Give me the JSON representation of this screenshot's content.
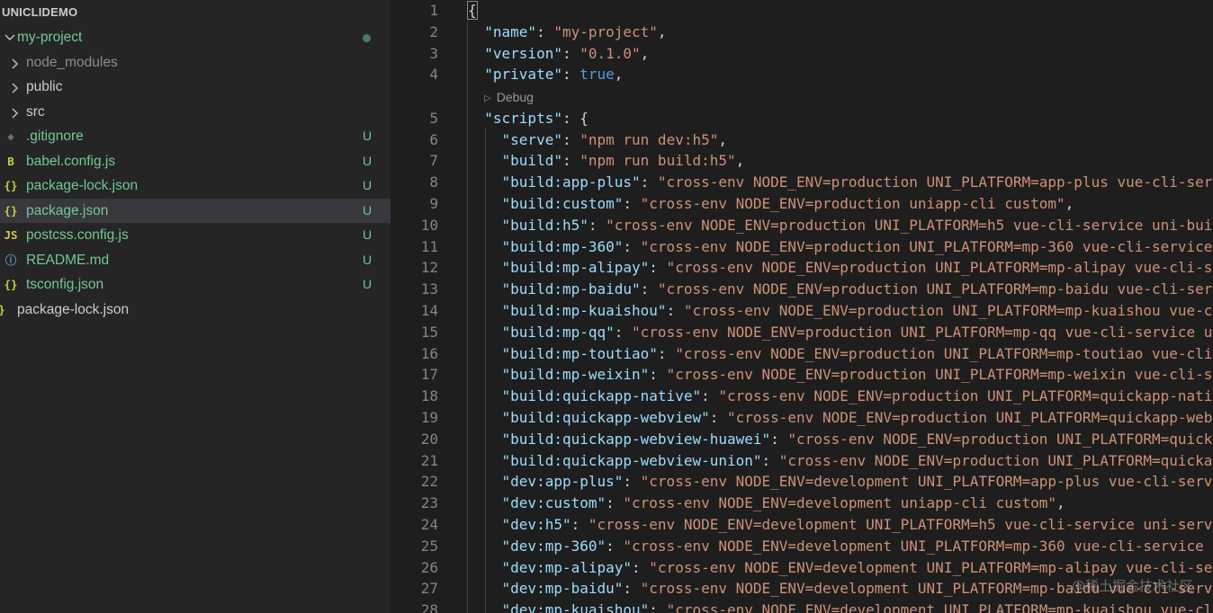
{
  "explorer": {
    "section_title": "UNICLIDEMO",
    "root": {
      "label": "my-project",
      "color": "#73c991"
    },
    "items": [
      {
        "name": "node_modules",
        "type": "folder",
        "color": "#8c8c8c",
        "status": ""
      },
      {
        "name": "public",
        "type": "folder",
        "color": "#cccccc",
        "status": ""
      },
      {
        "name": "src",
        "type": "folder",
        "color": "#cccccc",
        "status": ""
      },
      {
        "name": ".gitignore",
        "type": "file",
        "icon": "git-icon",
        "glyph": "◆",
        "icon_color": "#6d6d6d",
        "color": "#73c991",
        "status": "U"
      },
      {
        "name": "babel.config.js",
        "type": "file",
        "icon": "babel-icon",
        "glyph": "B",
        "icon_color": "#cbcb41",
        "color": "#73c991",
        "status": "U"
      },
      {
        "name": "package-lock.json",
        "type": "file",
        "icon": "json-icon",
        "glyph": "{}",
        "icon_color": "#cbcb41",
        "color": "#73c991",
        "status": "U"
      },
      {
        "name": "package.json",
        "type": "file",
        "icon": "json-icon",
        "glyph": "{}",
        "icon_color": "#cbcb41",
        "color": "#73c991",
        "status": "U",
        "selected": true
      },
      {
        "name": "postcss.config.js",
        "type": "file",
        "icon": "js-icon",
        "glyph": "JS",
        "icon_color": "#cbcb41",
        "color": "#73c991",
        "status": "U"
      },
      {
        "name": "README.md",
        "type": "file",
        "icon": "info-icon",
        "glyph": "ⓘ",
        "icon_color": "#519aba",
        "color": "#73c991",
        "status": "U"
      },
      {
        "name": "tsconfig.json",
        "type": "file",
        "icon": "json-icon",
        "glyph": "{}",
        "icon_color": "#cbcb41",
        "color": "#73c991",
        "status": "U"
      }
    ],
    "outside_item": {
      "name": "package-lock.json",
      "icon": "json-icon",
      "glyph": "}",
      "icon_color": "#cbcb41",
      "color": "#cccccc"
    }
  },
  "editor": {
    "codelens": "Debug",
    "lines": [
      {
        "n": "1",
        "tokens": [
          [
            "punc",
            "{"
          ]
        ]
      },
      {
        "n": "2",
        "tokens": [
          [
            "punc",
            "  "
          ],
          [
            "key",
            "\"name\""
          ],
          [
            "punc",
            ": "
          ],
          [
            "str",
            "\"my-project\""
          ],
          [
            "punc",
            ","
          ]
        ]
      },
      {
        "n": "3",
        "tokens": [
          [
            "punc",
            "  "
          ],
          [
            "key",
            "\"version\""
          ],
          [
            "punc",
            ": "
          ],
          [
            "str",
            "\"0.1.0\""
          ],
          [
            "punc",
            ","
          ]
        ]
      },
      {
        "n": "4",
        "tokens": [
          [
            "punc",
            "  "
          ],
          [
            "key",
            "\"private\""
          ],
          [
            "punc",
            ": "
          ],
          [
            "kw",
            "true"
          ],
          [
            "punc",
            ","
          ]
        ]
      },
      {
        "n": "5",
        "tokens": [
          [
            "punc",
            "  "
          ],
          [
            "key",
            "\"scripts\""
          ],
          [
            "punc",
            ": {"
          ]
        ]
      },
      {
        "n": "6",
        "tokens": [
          [
            "punc",
            "    "
          ],
          [
            "key",
            "\"serve\""
          ],
          [
            "punc",
            ": "
          ],
          [
            "str",
            "\"npm run dev:h5\""
          ],
          [
            "punc",
            ","
          ]
        ]
      },
      {
        "n": "7",
        "tokens": [
          [
            "punc",
            "    "
          ],
          [
            "key",
            "\"build\""
          ],
          [
            "punc",
            ": "
          ],
          [
            "str",
            "\"npm run build:h5\""
          ],
          [
            "punc",
            ","
          ]
        ]
      },
      {
        "n": "8",
        "tokens": [
          [
            "punc",
            "    "
          ],
          [
            "key",
            "\"build:app-plus\""
          ],
          [
            "punc",
            ": "
          ],
          [
            "str",
            "\"cross-env NODE_ENV=production UNI_PLATFORM=app-plus vue-cli-serv"
          ]
        ]
      },
      {
        "n": "9",
        "tokens": [
          [
            "punc",
            "    "
          ],
          [
            "key",
            "\"build:custom\""
          ],
          [
            "punc",
            ": "
          ],
          [
            "str",
            "\"cross-env NODE_ENV=production uniapp-cli custom\""
          ],
          [
            "punc",
            ","
          ]
        ]
      },
      {
        "n": "10",
        "tokens": [
          [
            "punc",
            "    "
          ],
          [
            "key",
            "\"build:h5\""
          ],
          [
            "punc",
            ": "
          ],
          [
            "str",
            "\"cross-env NODE_ENV=production UNI_PLATFORM=h5 vue-cli-service uni-bui"
          ]
        ]
      },
      {
        "n": "11",
        "tokens": [
          [
            "punc",
            "    "
          ],
          [
            "key",
            "\"build:mp-360\""
          ],
          [
            "punc",
            ": "
          ],
          [
            "str",
            "\"cross-env NODE_ENV=production UNI_PLATFORM=mp-360 vue-cli-service"
          ]
        ]
      },
      {
        "n": "12",
        "tokens": [
          [
            "punc",
            "    "
          ],
          [
            "key",
            "\"build:mp-alipay\""
          ],
          [
            "punc",
            ": "
          ],
          [
            "str",
            "\"cross-env NODE_ENV=production UNI_PLATFORM=mp-alipay vue-cli-se"
          ]
        ]
      },
      {
        "n": "13",
        "tokens": [
          [
            "punc",
            "    "
          ],
          [
            "key",
            "\"build:mp-baidu\""
          ],
          [
            "punc",
            ": "
          ],
          [
            "str",
            "\"cross-env NODE_ENV=production UNI_PLATFORM=mp-baidu vue-cli-serv"
          ]
        ]
      },
      {
        "n": "14",
        "tokens": [
          [
            "punc",
            "    "
          ],
          [
            "key",
            "\"build:mp-kuaishou\""
          ],
          [
            "punc",
            ": "
          ],
          [
            "str",
            "\"cross-env NODE_ENV=production UNI_PLATFORM=mp-kuaishou vue-c"
          ]
        ]
      },
      {
        "n": "15",
        "tokens": [
          [
            "punc",
            "    "
          ],
          [
            "key",
            "\"build:mp-qq\""
          ],
          [
            "punc",
            ": "
          ],
          [
            "str",
            "\"cross-env NODE_ENV=production UNI_PLATFORM=mp-qq vue-cli-service u"
          ]
        ]
      },
      {
        "n": "16",
        "tokens": [
          [
            "punc",
            "    "
          ],
          [
            "key",
            "\"build:mp-toutiao\""
          ],
          [
            "punc",
            ": "
          ],
          [
            "str",
            "\"cross-env NODE_ENV=production UNI_PLATFORM=mp-toutiao vue-cli"
          ]
        ]
      },
      {
        "n": "17",
        "tokens": [
          [
            "punc",
            "    "
          ],
          [
            "key",
            "\"build:mp-weixin\""
          ],
          [
            "punc",
            ": "
          ],
          [
            "str",
            "\"cross-env NODE_ENV=production UNI_PLATFORM=mp-weixin vue-cli-se"
          ]
        ]
      },
      {
        "n": "18",
        "tokens": [
          [
            "punc",
            "    "
          ],
          [
            "key",
            "\"build:quickapp-native\""
          ],
          [
            "punc",
            ": "
          ],
          [
            "str",
            "\"cross-env NODE_ENV=production UNI_PLATFORM=quickapp-nativ"
          ]
        ]
      },
      {
        "n": "19",
        "tokens": [
          [
            "punc",
            "    "
          ],
          [
            "key",
            "\"build:quickapp-webview\""
          ],
          [
            "punc",
            ": "
          ],
          [
            "str",
            "\"cross-env NODE_ENV=production UNI_PLATFORM=quickapp-webv"
          ]
        ]
      },
      {
        "n": "20",
        "tokens": [
          [
            "punc",
            "    "
          ],
          [
            "key",
            "\"build:quickapp-webview-huawei\""
          ],
          [
            "punc",
            ": "
          ],
          [
            "str",
            "\"cross-env NODE_ENV=production UNI_PLATFORM=quicka"
          ]
        ]
      },
      {
        "n": "21",
        "tokens": [
          [
            "punc",
            "    "
          ],
          [
            "key",
            "\"build:quickapp-webview-union\""
          ],
          [
            "punc",
            ": "
          ],
          [
            "str",
            "\"cross-env NODE_ENV=production UNI_PLATFORM=quickap"
          ]
        ]
      },
      {
        "n": "22",
        "tokens": [
          [
            "punc",
            "    "
          ],
          [
            "key",
            "\"dev:app-plus\""
          ],
          [
            "punc",
            ": "
          ],
          [
            "str",
            "\"cross-env NODE_ENV=development UNI_PLATFORM=app-plus vue-cli-serv"
          ]
        ]
      },
      {
        "n": "23",
        "tokens": [
          [
            "punc",
            "    "
          ],
          [
            "key",
            "\"dev:custom\""
          ],
          [
            "punc",
            ": "
          ],
          [
            "str",
            "\"cross-env NODE_ENV=development uniapp-cli custom\""
          ],
          [
            "punc",
            ","
          ]
        ]
      },
      {
        "n": "24",
        "tokens": [
          [
            "punc",
            "    "
          ],
          [
            "key",
            "\"dev:h5\""
          ],
          [
            "punc",
            ": "
          ],
          [
            "str",
            "\"cross-env NODE_ENV=development UNI_PLATFORM=h5 vue-cli-service uni-serv"
          ]
        ]
      },
      {
        "n": "25",
        "tokens": [
          [
            "punc",
            "    "
          ],
          [
            "key",
            "\"dev:mp-360\""
          ],
          [
            "punc",
            ": "
          ],
          [
            "str",
            "\"cross-env NODE_ENV=development UNI_PLATFORM=mp-360 vue-cli-service"
          ]
        ]
      },
      {
        "n": "26",
        "tokens": [
          [
            "punc",
            "    "
          ],
          [
            "key",
            "\"dev:mp-alipay\""
          ],
          [
            "punc",
            ": "
          ],
          [
            "str",
            "\"cross-env NODE_ENV=development UNI_PLATFORM=mp-alipay vue-cli-se"
          ]
        ]
      },
      {
        "n": "27",
        "tokens": [
          [
            "punc",
            "    "
          ],
          [
            "key",
            "\"dev:mp-baidu\""
          ],
          [
            "punc",
            ": "
          ],
          [
            "str",
            "\"cross-env NODE_ENV=development UNI_PLATFORM=mp-baidu vue-cli-serv"
          ]
        ]
      },
      {
        "n": "28",
        "tokens": [
          [
            "punc",
            "    "
          ],
          [
            "key",
            "\"dev:mp-kuaishou\""
          ],
          [
            "punc",
            ": "
          ],
          [
            "str",
            "\"cross-env NODE_ENV=development UNI_PLATFORM=mp-kuaishou vue-cli"
          ]
        ]
      }
    ]
  },
  "watermark": "@稀土掘金技术社区"
}
